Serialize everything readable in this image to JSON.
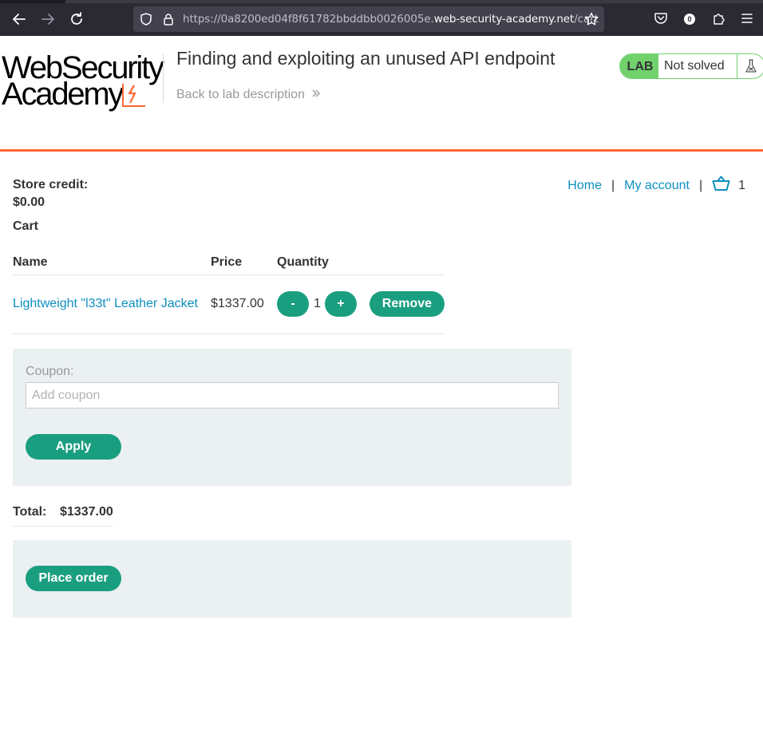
{
  "browser": {
    "url_prefix": "https://0a8200ed04f8f61782bbddbb0026005e.",
    "url_host": "web-security-academy.net",
    "url_path": "/cart",
    "extension_badge": "0"
  },
  "header": {
    "logo_line1": "WebSecurity",
    "logo_line2": "Academy",
    "lab_title": "Finding and exploiting an unused API endpoint",
    "back_link": "Back to lab description",
    "lab_tag": "LAB",
    "lab_status": "Not solved"
  },
  "account": {
    "store_credit_label": "Store credit:",
    "store_credit_value": "$0.00"
  },
  "nav": {
    "home": "Home",
    "separator": "|",
    "my_account": "My account",
    "cart_count": "1"
  },
  "cart": {
    "heading": "Cart",
    "columns": [
      "Name",
      "Price",
      "Quantity"
    ],
    "items": [
      {
        "name": "Lightweight \"l33t\" Leather Jacket",
        "price": "$1337.00",
        "quantity": "1",
        "decrement_label": "-",
        "increment_label": "+",
        "remove_label": "Remove"
      }
    ]
  },
  "coupon": {
    "label": "Coupon:",
    "placeholder": "Add coupon",
    "value": "",
    "apply_label": "Apply"
  },
  "total": {
    "label": "Total:",
    "value": "$1337.00"
  },
  "order": {
    "place_order_label": "Place order"
  },
  "colors": {
    "accent_orange": "#ff6633",
    "button_green": "#1a9e80",
    "link_blue": "#0d8fc0",
    "lab_green": "#70d16d"
  }
}
